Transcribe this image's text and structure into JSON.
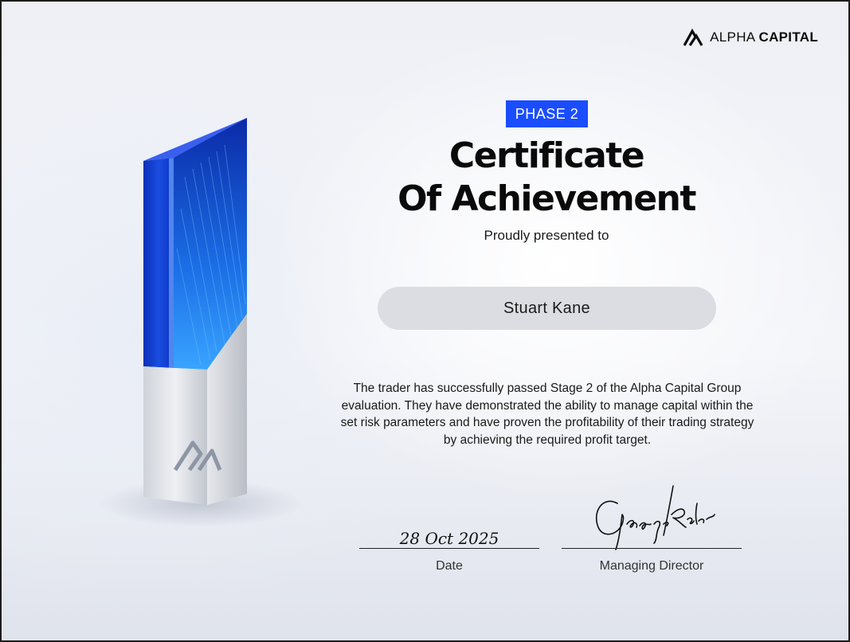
{
  "brand": {
    "light": "ALPHA ",
    "bold": "CAPITAL",
    "logo_icon": "alpha-capital-mountain-logo"
  },
  "badge": {
    "label": "PHASE 2",
    "color": "#1a4dff"
  },
  "title": {
    "line1": "Certificate",
    "line2": "Of Achievement"
  },
  "presented_to": "Proudly presented to",
  "recipient": "Stuart Kane",
  "description": "The trader has successfully passed Stage 2 of the Alpha Capital Group evaluation. They have demonstrated the ability to manage capital within the set risk parameters and have proven the profitability of their trading strategy by achieving the required profit target.",
  "date": {
    "value": "28 Oct 2025",
    "label": "Date"
  },
  "signature": {
    "text": "George Kohler",
    "label": "Managing Director"
  },
  "colors": {
    "accent": "#1a4dff",
    "trophy_glass": "#1243d6"
  }
}
